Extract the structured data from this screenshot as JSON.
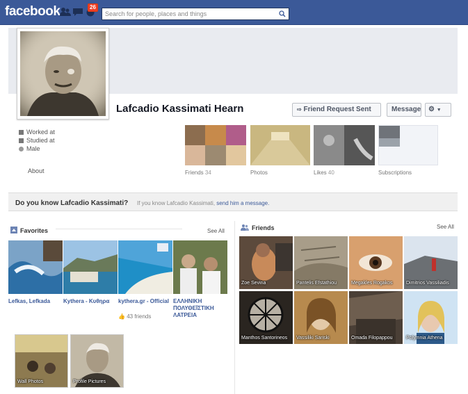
{
  "topbar": {
    "logo": "facebook",
    "notification_count": "26",
    "search_placeholder": "Search for people, places and things"
  },
  "profile": {
    "name": "Lafcadio Kassimati Hearn",
    "friend_request_label": "Friend Request Sent",
    "message_label": "Message",
    "info": [
      "Worked at",
      "Studied at",
      "Male"
    ],
    "about_label": "About"
  },
  "tiles": {
    "friends_label": "Friends",
    "friends_count": "34",
    "photos_label": "Photos",
    "likes_label": "Likes",
    "likes_count": "40",
    "subscriptions_label": "Subscriptions"
  },
  "know_banner": {
    "title": "Do you know Lafcadio Kassimati?",
    "text": "If you know Lafcadio Kassimati,",
    "link": "send him a message."
  },
  "favorites": {
    "title": "Favorites",
    "see_all": "See All",
    "items": [
      {
        "label": "Lefkas, Lefkada"
      },
      {
        "label": "Kythera - Κυθηρα"
      },
      {
        "label": "kythera.gr - Official",
        "sub": "43 friends"
      },
      {
        "label": "ΕΛΛΗΝΙΚΗ ΠΟΛΥΘΕΪΣΤΙΚΗ ΛΑΤΡΕΙΑ"
      }
    ]
  },
  "albums": [
    {
      "label": "Wall Photos"
    },
    {
      "label": "Profile Pictures"
    }
  ],
  "friends": {
    "title": "Friends",
    "see_all": "See All",
    "items": [
      {
        "name": "Zoe Sevina"
      },
      {
        "name": "Pantelis Efstathiou"
      },
      {
        "name": "Megakles Rogakos"
      },
      {
        "name": "Dimitrios Vassiliadis"
      },
      {
        "name": "Manthos Santorineos"
      },
      {
        "name": "Vassiliki Sariski"
      },
      {
        "name": "Omada Filopappou"
      },
      {
        "name": "Polymnia Athena"
      }
    ]
  },
  "colors": {
    "brand": "#3b5998",
    "badge": "#f03d25"
  }
}
